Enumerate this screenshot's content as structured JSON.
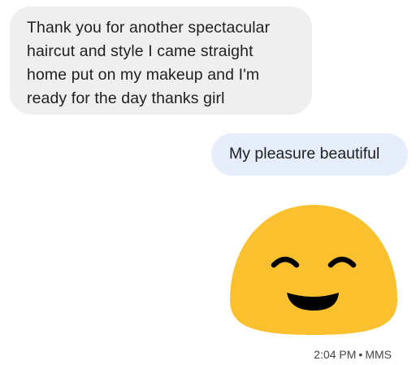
{
  "conversation": {
    "incoming_message": {
      "lines": [
        "Thank you for another spectacular",
        "haircut and style I came straight",
        "home put on my makeup and I'm",
        "ready for the day thanks girl"
      ]
    },
    "outgoing_message": {
      "text": "My pleasure beautiful"
    },
    "emoji": {
      "icon": "smiling-face-with-smiling-eyes-icon",
      "color": "#fbc02d",
      "feature_color": "#000000"
    },
    "meta": {
      "time": "2:04 PM",
      "separator": "•",
      "type": "MMS"
    }
  },
  "colors": {
    "incoming_bubble": "#efefef",
    "outgoing_bubble": "#e6eefb",
    "text": "#1f1f1f"
  }
}
